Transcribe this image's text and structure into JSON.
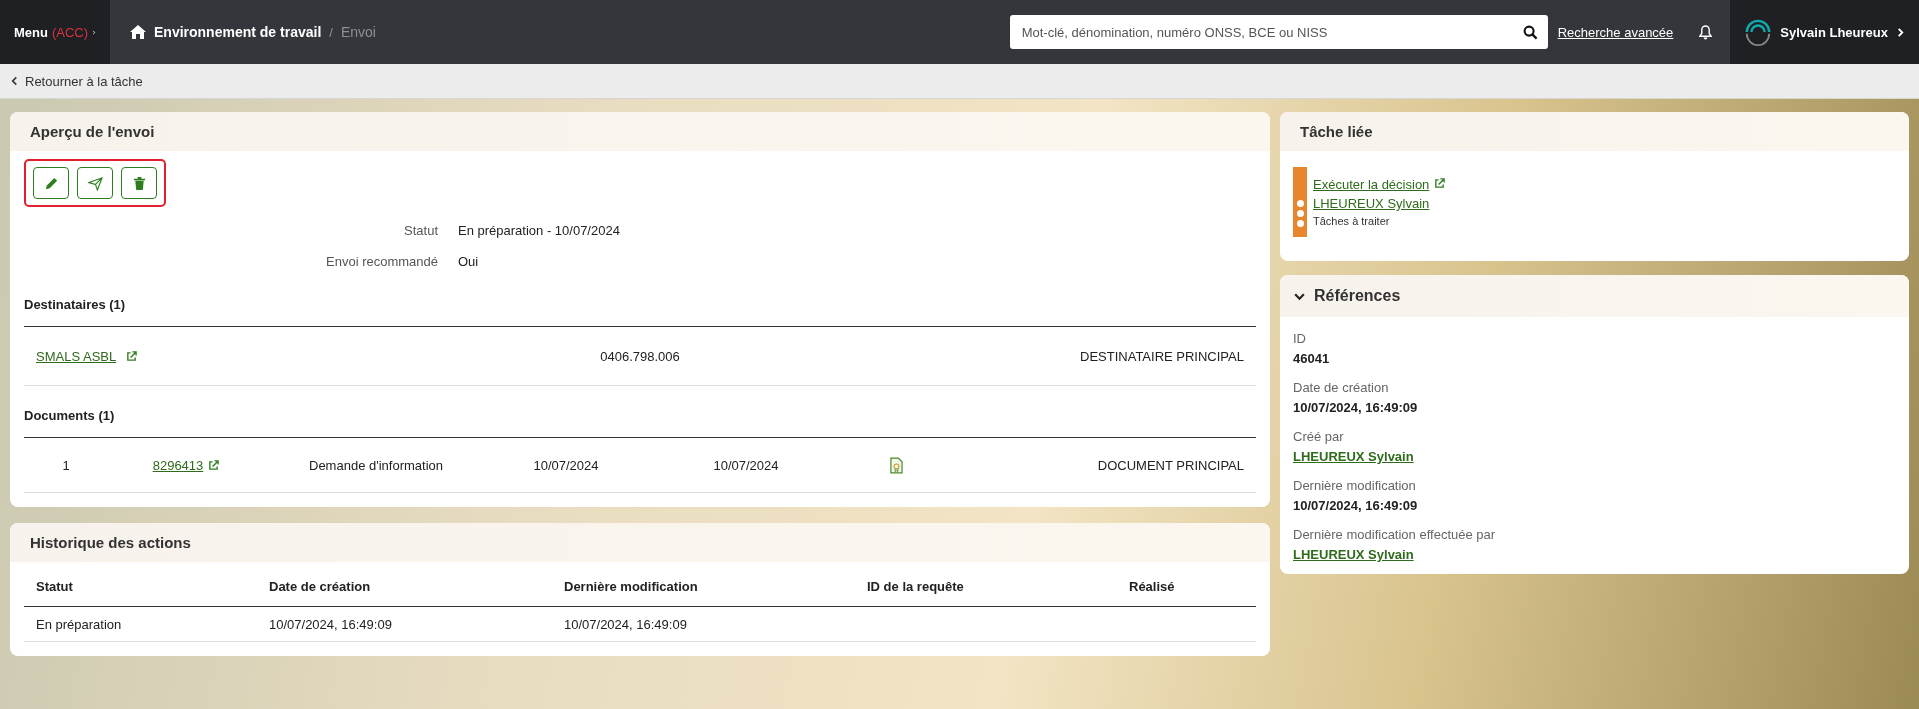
{
  "top_bar": {
    "menu": {
      "label": "Menu",
      "env": "(ACC)"
    },
    "breadcrumb_separator": "/",
    "breadcrumb": [
      {
        "label": "Environnement de travail",
        "current": false
      },
      {
        "label": "Envoi",
        "current": true
      }
    ],
    "search": {
      "placeholder": "Mot-clé, dénomination, numéro ONSS, BCE ou NISS"
    },
    "advanced_search": "Recherche avancée",
    "user": "Sylvain Lheureux"
  },
  "back_link": "Retourner à la tâche",
  "overview": {
    "title": "Aperçu de l'envoi",
    "actions": [
      {
        "kind": "edit"
      },
      {
        "kind": "send"
      },
      {
        "kind": "delete"
      }
    ],
    "fields": [
      {
        "label": "Statut",
        "value": "En préparation - 10/07/2024"
      },
      {
        "label": "Envoi recommandé",
        "value": "Oui"
      }
    ],
    "recipients": {
      "title": "Destinataires (1)",
      "rows": [
        {
          "name": "SMALS ASBL",
          "number": "0406.798.006",
          "role": "DESTINATAIRE PRINCIPAL"
        }
      ]
    },
    "documents": {
      "title": "Documents (1)",
      "rows": [
        {
          "index": "1",
          "number": "8296413",
          "description": "Demande d'information",
          "date_1": "10/07/2024",
          "date_2": "10/07/2024",
          "role": "DOCUMENT PRINCIPAL"
        }
      ]
    }
  },
  "history": {
    "title": "Historique des actions",
    "columns": [
      "Statut",
      "Date de création",
      "Dernière modification",
      "ID de la requête",
      "Réalisé"
    ],
    "rows": [
      [
        "En préparation",
        "10/07/2024, 16:49:09",
        "10/07/2024, 16:49:09",
        "",
        ""
      ]
    ]
  },
  "linked_task": {
    "title": "Tâche liée",
    "task": "Exécuter la décision",
    "assignee": "LHEUREUX Sylvain",
    "queue": "Tâches à traiter",
    "color": "#e8862e"
  },
  "references": {
    "title": "Références",
    "expanded": true,
    "items": [
      {
        "label": "ID",
        "value": "46041",
        "kind": "text"
      },
      {
        "label": "Date de création",
        "value": "10/07/2024, 16:49:09",
        "kind": "text"
      },
      {
        "label": "Créé par",
        "value": "LHEUREUX Sylvain",
        "kind": "link"
      },
      {
        "label": "Dernière modification",
        "value": "10/07/2024, 16:49:09",
        "kind": "text"
      },
      {
        "label": "Dernière modification effectuée par",
        "value": "LHEUREUX Sylvain",
        "kind": "link"
      }
    ]
  }
}
